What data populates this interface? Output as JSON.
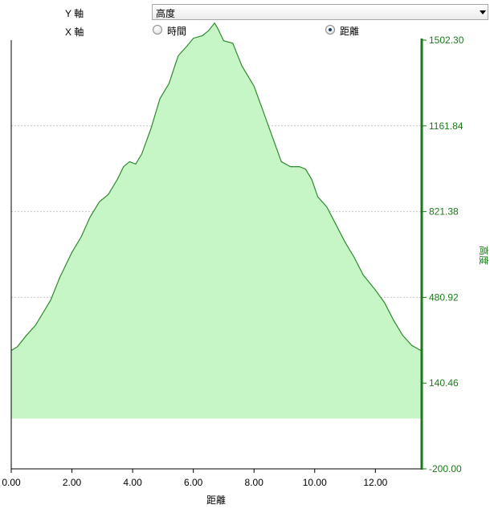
{
  "controls": {
    "y_axis_label": "Y 軸",
    "x_axis_label": "X 軸",
    "y_select_value": "高度",
    "x_options": [
      {
        "label": "時間",
        "checked": false
      },
      {
        "label": "距離",
        "checked": true
      }
    ]
  },
  "colors": {
    "fill": "#c6f5c6",
    "line": "#2e8b2e",
    "axis_right": "#1a7a1a",
    "tick_text_right": "#1a7a1a",
    "grid": "#c8c8c8"
  },
  "chart_data": {
    "type": "area",
    "xlabel": "距離",
    "ylabel": "高度",
    "xlim": [
      0,
      13.5
    ],
    "ylim": [
      -200,
      1502.3
    ],
    "x_ticks": [
      "0.00",
      "2.00",
      "4.00",
      "6.00",
      "8.00",
      "10.00",
      "12.00"
    ],
    "y_ticks": [
      "-200.00",
      "140.46",
      "480.92",
      "821.38",
      "1161.84",
      "1502.30"
    ],
    "grid": "horizontal dashed",
    "baseline": 0,
    "x": [
      0,
      0.2,
      0.5,
      0.8,
      1.0,
      1.3,
      1.6,
      2.0,
      2.3,
      2.6,
      2.9,
      3.2,
      3.5,
      3.7,
      3.9,
      4.1,
      4.3,
      4.6,
      4.9,
      5.2,
      5.5,
      5.8,
      6.0,
      6.3,
      6.5,
      6.7,
      6.8,
      7.0,
      7.3,
      7.6,
      8.0,
      8.3,
      8.6,
      8.9,
      9.2,
      9.5,
      9.7,
      9.9,
      10.1,
      10.4,
      10.7,
      11.0,
      11.3,
      11.6,
      12.0,
      12.3,
      12.6,
      12.9,
      13.2,
      13.5
    ],
    "y": [
      270,
      285,
      330,
      370,
      410,
      470,
      560,
      660,
      720,
      800,
      860,
      890,
      950,
      1000,
      1020,
      1010,
      1050,
      1150,
      1270,
      1330,
      1440,
      1480,
      1510,
      1520,
      1540,
      1570,
      1550,
      1500,
      1490,
      1400,
      1320,
      1220,
      1120,
      1020,
      1000,
      1000,
      990,
      950,
      880,
      840,
      770,
      700,
      640,
      570,
      510,
      460,
      390,
      330,
      290,
      270
    ]
  }
}
